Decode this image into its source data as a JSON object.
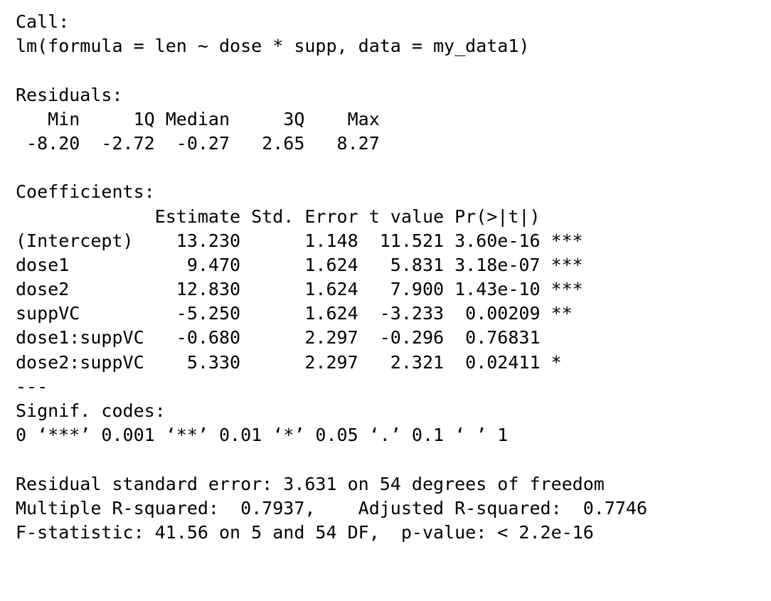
{
  "output": {
    "call_header": "Call:",
    "call_formula": "lm(formula = len ~ dose * supp, data = my_data1)",
    "residuals_header": "Residuals:",
    "residuals_labels": "   Min     1Q Median     3Q    Max ",
    "residuals_values": " -8.20  -2.72  -0.27   2.65   8.27 ",
    "coefficients_header": "Coefficients:",
    "coef_column_header": "             Estimate Std. Error t value Pr(>|t|)    ",
    "coef_rows": [
      "(Intercept)    13.230      1.148  11.521 3.60e-16 ***",
      "dose1           9.470      1.624   5.831 3.18e-07 ***",
      "dose2          12.830      1.624   7.900 1.43e-10 ***",
      "suppVC         -5.250      1.624  -3.233  0.00209 ** ",
      "dose1:suppVC   -0.680      2.297  -0.296  0.76831    ",
      "dose2:suppVC    5.330      2.297   2.321  0.02411 *  "
    ],
    "separator": "---",
    "signif_header": "Signif. codes:",
    "signif_codes": "0 ‘***’ 0.001 ‘**’ 0.01 ‘*’ 0.05 ‘.’ 0.1 ‘ ’ 1",
    "residual_se": "Residual standard error: 3.631 on 54 degrees of freedom",
    "r_squared": "Multiple R-squared:  0.7937,    Adjusted R-squared:  0.7746 ",
    "f_statistic": "F-statistic: 41.56 on 5 and 54 DF,  p-value: < 2.2e-16"
  }
}
